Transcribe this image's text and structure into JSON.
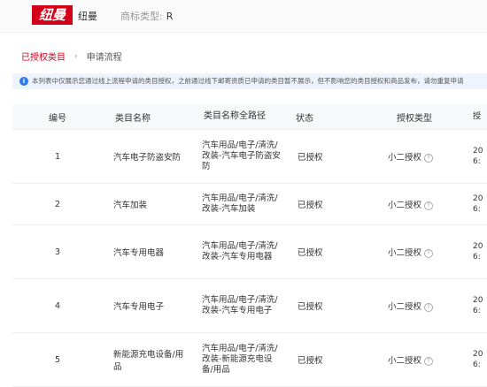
{
  "header": {
    "logo_text": "纽曼",
    "brand_name": "纽曼",
    "trademark_label": "商标类型:",
    "trademark_value": "R"
  },
  "breadcrumb": {
    "link": "已授权类目",
    "current": "申请流程"
  },
  "notice": {
    "text": "本列表中仅展示您通过线上流程申请的类目授权，之前通过线下邮寄资质已申请的类目暂不展示，但不影响您的类目授权和商品发布，请勿重复申请"
  },
  "table": {
    "headers": [
      "编号",
      "类目名称",
      "类目名称全路径",
      "状态",
      "授权类型",
      "授"
    ],
    "rows": [
      {
        "no": "1",
        "name": "汽车电子防盗安防",
        "path": "汽车用品/电子/清洗/改装-汽车电子防盗安防",
        "status": "已授权",
        "auth_type": "小二授权",
        "extra": "20\n6:"
      },
      {
        "no": "2",
        "name": "汽车加装",
        "path": "汽车用品/电子/清洗/改装-汽车加装",
        "status": "已授权",
        "auth_type": "小二授权",
        "extra": "20\n6:"
      },
      {
        "no": "3",
        "name": "汽车专用电器",
        "path": "汽车用品/电子/清洗/改装-汽车专用电器",
        "status": "已授权",
        "auth_type": "小二授权",
        "extra": "20\n6:"
      },
      {
        "no": "4",
        "name": "汽车专用电子",
        "path": "汽车用品/电子/清洗/改装-汽车专用电子",
        "status": "已授权",
        "auth_type": "小二授权",
        "extra": "20\n6:"
      },
      {
        "no": "5",
        "name": "新能源充电设备/用品",
        "path": "汽车用品/电子/清洗/改装-新能源充电设备/用品",
        "status": "已授权",
        "auth_type": "小二授权",
        "extra": "20\n6:"
      }
    ]
  }
}
